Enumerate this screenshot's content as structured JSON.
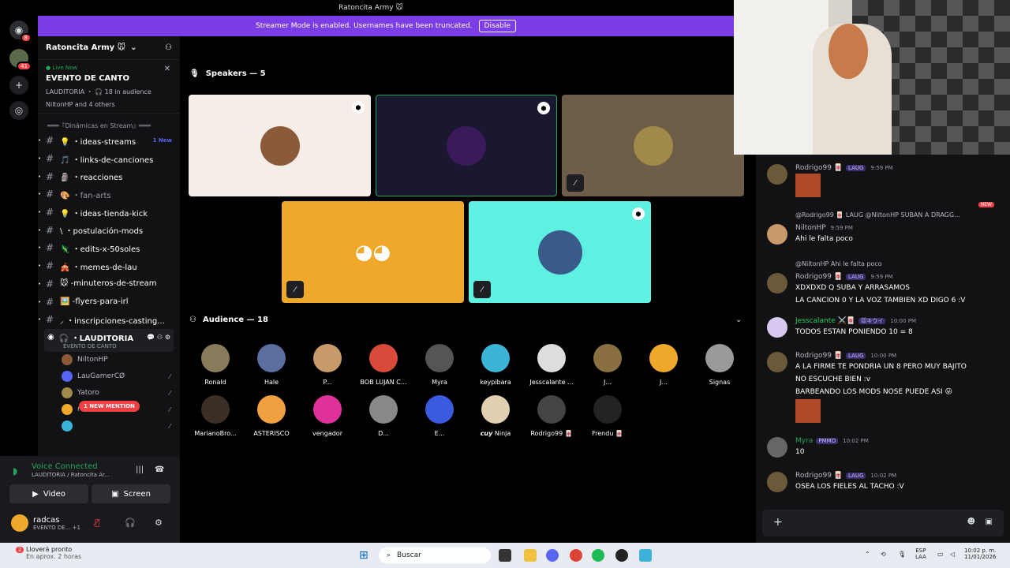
{
  "window": {
    "title": "Ratoncita Army 🐭"
  },
  "banner": {
    "text": "Streamer Mode is enabled. Usernames have been truncated.",
    "button": "Disable"
  },
  "rail": {
    "dm_badge": "8",
    "server_badge": "41"
  },
  "server": {
    "name": "Ratoncita Army 🐭"
  },
  "live": {
    "label": "Live Now",
    "title": "EVENTO DE CANTO",
    "meta": "LAUDITORIA ・ 🎧 18 in audience",
    "others": "NiltonHP and 4 others"
  },
  "category": "═══『Dinámicas en Stream』═══",
  "channels": [
    {
      "name": "💡 ・ideas-streams",
      "badge": "1 New",
      "dim": false
    },
    {
      "name": "🎵 ・links-de-canciones",
      "dim": false
    },
    {
      "name": "🗿 ・reacciones",
      "dim": false
    },
    {
      "name": "🎨 ・fan-arts",
      "dim": true
    },
    {
      "name": "💡 ・ideas-tienda-kick",
      "dim": false
    },
    {
      "name": "\\ ・postulación-mods",
      "dim": false
    },
    {
      "name": "🦎 ・edits-x-50soles",
      "dim": false
    },
    {
      "name": "🎪 ・memes-de-lau",
      "dim": false
    },
    {
      "name": "🐭 -minuteros-de-stream",
      "dim": false
    },
    {
      "name": "🖼️ -flyers-para-irl",
      "dim": false
    },
    {
      "name": "⸝ ・inscripciones-casting...",
      "dim": false
    }
  ],
  "voice": {
    "name": "🎧 ・LAUDITORIA",
    "sub": "EVENTO DE CANTO",
    "users": [
      "NiltonHP",
      "LauGamerCØ",
      "Yatoro",
      "radcas",
      ""
    ],
    "mention": "1 NEW MENTION"
  },
  "vcpanel": {
    "status": "Voice Connected",
    "channel": "LAUDITORIA / Ratoncita Ar...",
    "video": "Video",
    "screen": "Screen"
  },
  "me": {
    "name": "radcas",
    "status": "EVENTO DE... +1"
  },
  "stage": {
    "speakers": "Speakers — 5",
    "audience": "Audience — 18"
  },
  "audience": [
    {
      "name": "Ronald",
      "color": "#8a7a5c"
    },
    {
      "name": "Hale",
      "color": "#5a6fa0"
    },
    {
      "name": "P...",
      "color": "#c89a6a"
    },
    {
      "name": "BOB LUJAN C...",
      "color": "#d84a3a"
    },
    {
      "name": "Myra",
      "color": "#555"
    },
    {
      "name": "keypibara",
      "color": "#3cb4d8"
    },
    {
      "name": "Jesscalante ...",
      "color": "#ddd"
    },
    {
      "name": "J...",
      "color": "#8a7040"
    },
    {
      "name": "J...",
      "color": "#f0a82a"
    },
    {
      "name": "Signas",
      "color": "#9a9a9a"
    },
    {
      "name": "MarianoBro...",
      "color": "#3a3028"
    },
    {
      "name": "ASTERISCO",
      "color": "#f0a040"
    },
    {
      "name": "vengador",
      "color": "#e0309a"
    },
    {
      "name": "D...",
      "color": "#888"
    },
    {
      "name": "E...",
      "color": "#3a5ae0"
    },
    {
      "name": "𝙘𝙪𝙮 Ninja",
      "color": "#e0d0b0"
    },
    {
      "name": "Rodrigo99 🀄",
      "color": "#444"
    },
    {
      "name": "Frendu 🀄",
      "color": "#222"
    }
  ],
  "chat": [
    {
      "name": "Rodrigo99 🀄",
      "tag": "LAUG",
      "time": "9:59 PM",
      "text": ""
    },
    {
      "reply": "@Rodrigo99 🀄 LAUG @NiltonHP SUBAN A DRAGG...",
      "name": "NiltonHP",
      "time": "9:59 PM",
      "text": "Ahi le falta poco"
    },
    {
      "reply": "@NiltonHP Ahi le falta poco",
      "name": "Rodrigo99 🀄",
      "tag": "LAUG",
      "time": "9:59 PM",
      "text": "XDXDXD Q SUBA Y ARRASAMOS",
      "text2": "LA CANCION 0 Y LA VOZ TAMBIEN XD DIGO 6 :V"
    },
    {
      "name": "Jesscalante ⚔️🀄",
      "tag": "🐭キウイ",
      "time": "10:00 PM",
      "text": "TODOS ESTAN PONIENDO 10 = 8"
    },
    {
      "name": "Rodrigo99 🀄",
      "tag": "LAUG",
      "time": "10:00 PM",
      "text": "A LA FIRME TE PONDRIA UN 8 PERO MUY BAJITO",
      "text2": "NO ESCUCHE BIEN :v",
      "text3": "BARBEANDO LOS MODS NOSE PUEDE ASI 😛"
    },
    {
      "name": "Myra",
      "tag": "PMMO",
      "time": "10:02 PM",
      "text": "10"
    },
    {
      "name": "Rodrigo99 🀄",
      "tag": "LAUG",
      "time": "10:02 PM",
      "text": "OSEA LOS FIELES AL TACHO :V"
    }
  ],
  "new_label": "NEW",
  "taskbar": {
    "weather1": "Lloverá pronto",
    "weather2": "En aprox. 2 horas",
    "search": "Buscar",
    "lang1": "ESP",
    "lang2": "LAA",
    "time": "10:02 p. m.",
    "date": "11/01/2026",
    "notif": "2"
  }
}
